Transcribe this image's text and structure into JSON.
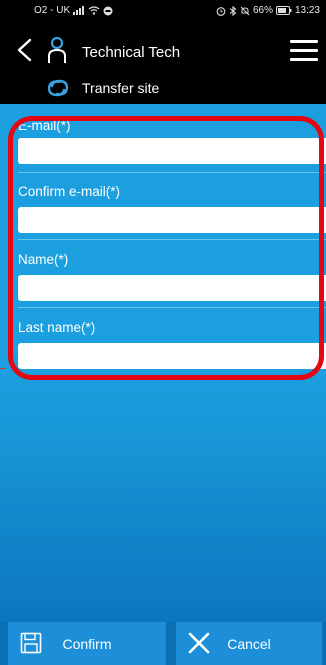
{
  "status_bar": {
    "carrier": "O2 - UK",
    "battery": "66%",
    "time": "13:23",
    "icons": [
      "signal-icon",
      "wifi-icon",
      "data-icon",
      "alarm-icon",
      "bluetooth-icon",
      "mute-icon",
      "battery-icon"
    ]
  },
  "header": {
    "title": "Technical Tech",
    "subtitle": "Transfer site",
    "icons": [
      "back-arrow-icon",
      "user-icon",
      "menu-icon",
      "transfer-icon"
    ]
  },
  "form": {
    "fields": [
      {
        "label": "E-mail(*)",
        "value": ""
      },
      {
        "label": "Confirm e-mail(*)",
        "value": ""
      },
      {
        "label": "Name(*)",
        "value": ""
      },
      {
        "label": "Last name(*)",
        "value": ""
      }
    ]
  },
  "actions": {
    "confirm_label": "Confirm",
    "cancel_label": "Cancel",
    "icons": [
      "save-icon",
      "close-icon"
    ]
  },
  "colors": {
    "header_bg": "#000000",
    "main_bg": "#1b9fde",
    "highlight": "#e30613",
    "button_bg": "#1d8fd8"
  }
}
